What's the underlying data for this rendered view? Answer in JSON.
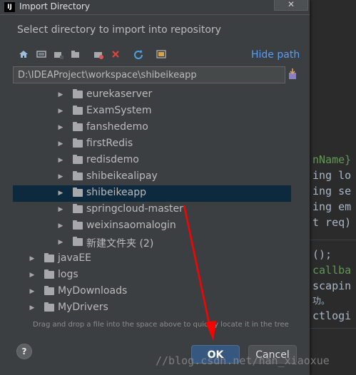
{
  "dialog": {
    "title": "Import Directory",
    "close_glyph": "✕",
    "title_icon_text": "IJ",
    "description": "Select directory to import into repository",
    "hide_path_label": "Hide path",
    "path_value": "D:\\IDEAProject\\workspace\\shibeikeapp",
    "hint": "Drag and drop a file into the space above to quickly locate it in the tree",
    "help_label": "?",
    "ok_label": "OK",
    "cancel_label": "Cancel"
  },
  "toolbar": {
    "icons": [
      "home-icon",
      "desktop-icon",
      "project-folder-icon",
      "module-folder-icon",
      "new-folder-icon",
      "delete-icon",
      "refresh-icon",
      "show-hidden-icon"
    ]
  },
  "tree": {
    "rows": [
      {
        "label": "eurekaserver",
        "expanded": false,
        "selected": false
      },
      {
        "label": "ExamSystem",
        "expanded": false,
        "selected": false
      },
      {
        "label": "fanshedemo",
        "expanded": false,
        "selected": false
      },
      {
        "label": "firstRedis",
        "expanded": false,
        "selected": false
      },
      {
        "label": "redisdemo",
        "expanded": false,
        "selected": false
      },
      {
        "label": "shibeikealipay",
        "expanded": false,
        "selected": false
      },
      {
        "label": "shibeikeapp",
        "expanded": false,
        "selected": true
      },
      {
        "label": "springcloud-master",
        "expanded": false,
        "selected": false
      },
      {
        "label": "weixinsaomalogin",
        "expanded": false,
        "selected": false
      },
      {
        "label": "新建文件夹 (2)",
        "expanded": false,
        "selected": false
      },
      {
        "label": "javaEE",
        "expanded": false,
        "selected": false
      },
      {
        "label": "logs",
        "expanded": false,
        "selected": false
      },
      {
        "label": "MyDownloads",
        "expanded": false,
        "selected": false
      },
      {
        "label": "MyDrivers",
        "expanded": false,
        "selected": false
      }
    ]
  },
  "background_editor": {
    "lines": [
      "nName}",
      "ing lo",
      "ing se",
      "ing em",
      "t req)",
      "();",
      "callba",
      "scapin",
      "功。",
      "ctlogi"
    ]
  },
  "watermark": "//blog.csdn.net/han_xiaoxue",
  "colors": {
    "accent": "#589df6",
    "selection": "#0d293e",
    "ok_button": "#365880",
    "annotation_arrow": "#ff0000"
  }
}
